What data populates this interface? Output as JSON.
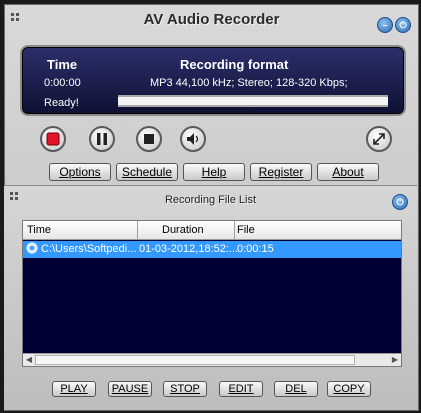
{
  "app": {
    "title": "AV Audio Recorder"
  },
  "display": {
    "time_label": "Time",
    "format_label": "Recording format",
    "time_value": "0:00:00",
    "format_value": "MP3 44,100 kHz; Stereo;  128-320 Kbps;",
    "status": "Ready!",
    "progress": 0
  },
  "menu": {
    "options": "Options",
    "schedule": "Schedule",
    "help": "Help",
    "register": "Register",
    "about": "About"
  },
  "list": {
    "title": "Recording File List",
    "columns": [
      "Time",
      "Duration",
      "File"
    ],
    "rows": [
      {
        "time": "C:\\Users\\Softpedi...",
        "duration": "01-03-2012,18:52:...",
        "file": "0:00:15"
      }
    ]
  },
  "actions": {
    "play": "PLAY",
    "pause": "PAUSE",
    "stop": "STOP",
    "edit": "EDIT",
    "del": "DEL",
    "copy": "COPY"
  },
  "colors": {
    "selected_row": "#3399ff",
    "lcd": "#1c1f4f",
    "record": "#e0142a"
  },
  "icons": [
    "record-icon",
    "pause-icon",
    "stop-icon",
    "volume-icon",
    "resize-icon",
    "minimize-icon",
    "power-icon"
  ]
}
